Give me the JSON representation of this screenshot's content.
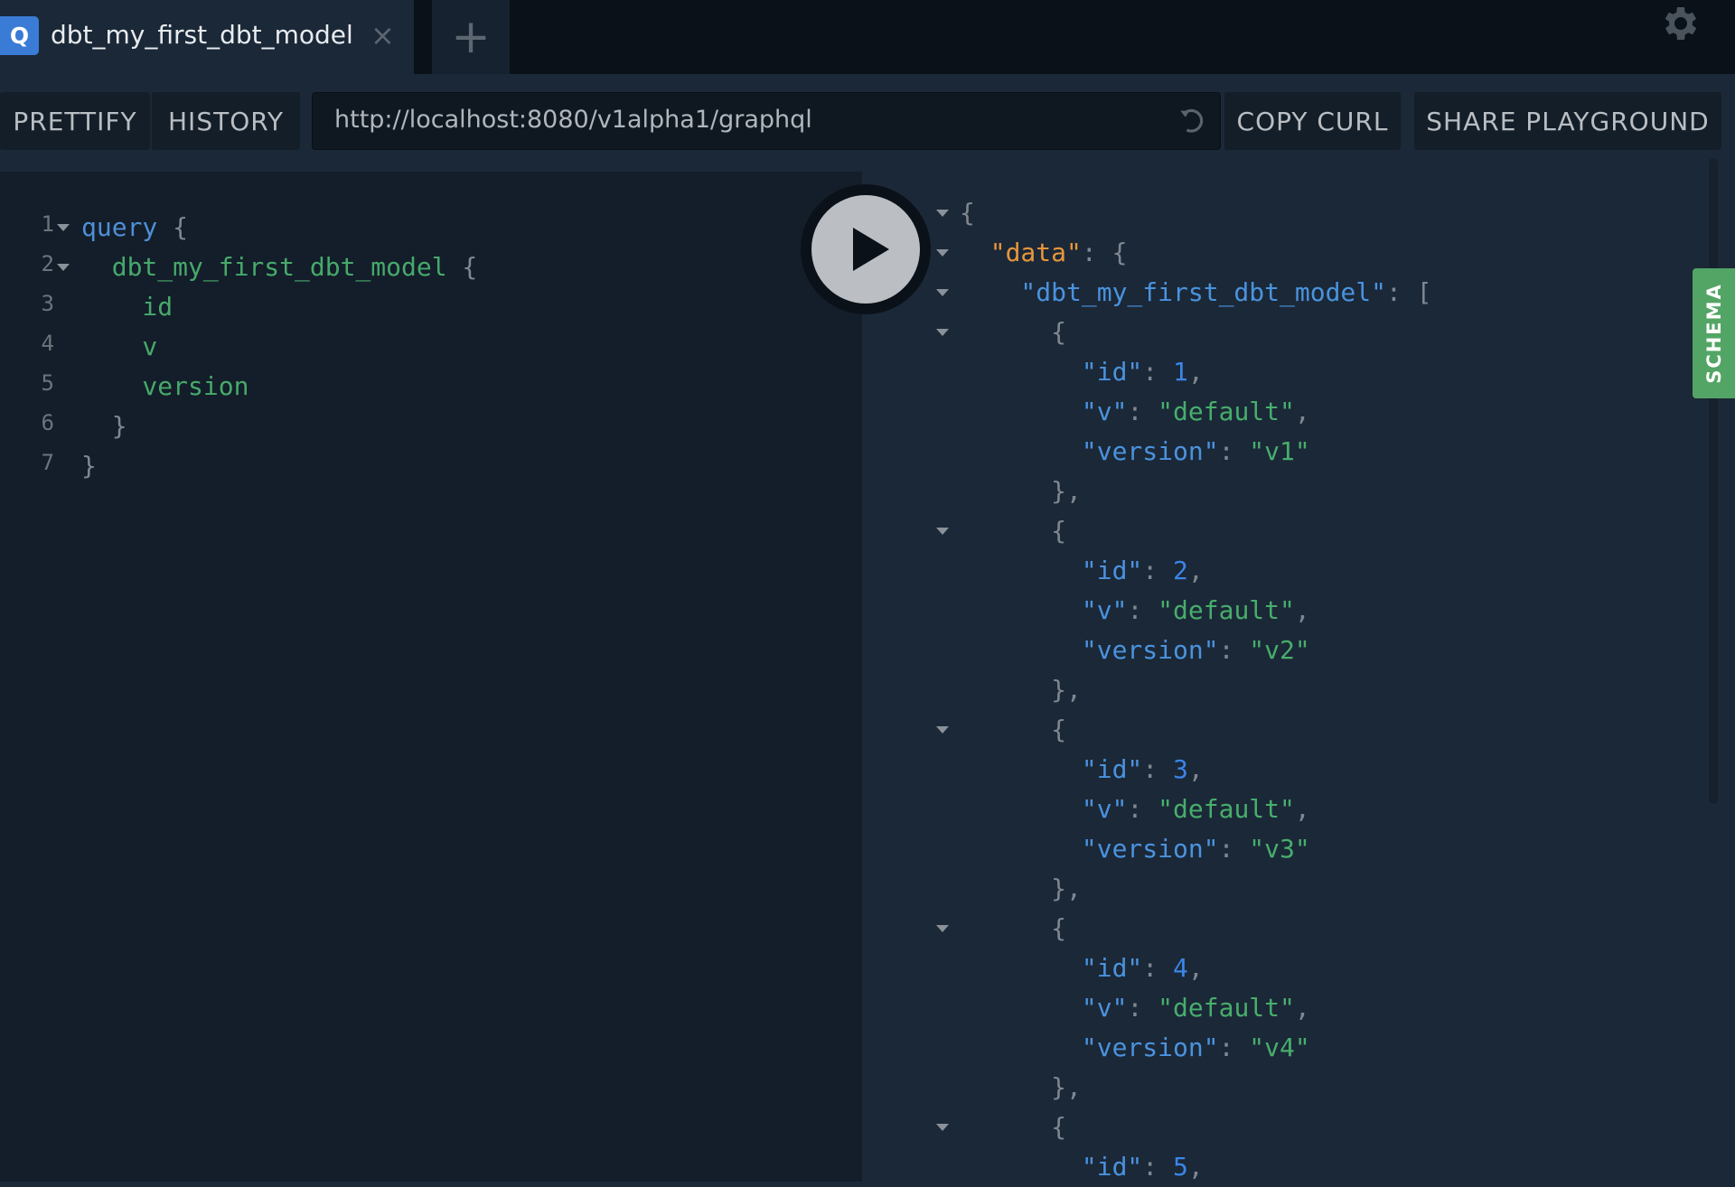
{
  "colors": {
    "accent": "#3a7bd5",
    "schema": "#53a565",
    "keyword": "#4f8fd6",
    "field": "#47a96a",
    "key": "#4a93de",
    "data_key": "#e8963a",
    "number": "#3b85e6",
    "string": "#47ae6b",
    "punct": "#7f8790"
  },
  "tabs": [
    {
      "badge": "Q",
      "title": "dbt_my_first_dbt_model",
      "close_icon": "×"
    }
  ],
  "new_tab_label": "+",
  "toolbar": {
    "prettify": "PRETTIFY",
    "history": "HISTORY",
    "endpoint": "http://localhost:8080/v1alpha1/graphql",
    "copy_curl": "COPY CURL",
    "share": "SHARE PLAYGROUND"
  },
  "schema_tab": "SCHEMA",
  "query_lines": [
    {
      "num": "1",
      "fold": true,
      "tokens": [
        [
          "keyword",
          "query"
        ],
        [
          "punct",
          " {"
        ]
      ]
    },
    {
      "num": "2",
      "fold": true,
      "tokens": [
        [
          "field",
          "  dbt_my_first_dbt_model"
        ],
        [
          "punct",
          " {"
        ]
      ]
    },
    {
      "num": "3",
      "tokens": [
        [
          "field",
          "    id"
        ]
      ]
    },
    {
      "num": "4",
      "tokens": [
        [
          "field",
          "    v"
        ]
      ]
    },
    {
      "num": "5",
      "tokens": [
        [
          "field",
          "    version"
        ]
      ]
    },
    {
      "num": "6",
      "tokens": [
        [
          "punct",
          "  }"
        ]
      ]
    },
    {
      "num": "7",
      "tokens": [
        [
          "punct",
          "}"
        ]
      ]
    }
  ],
  "result_lines": [
    {
      "fold": true,
      "tokens": [
        [
          "punct",
          "{"
        ]
      ]
    },
    {
      "fold": true,
      "tokens": [
        [
          "data_key",
          "  \"data\""
        ],
        [
          "punct",
          ": {"
        ]
      ]
    },
    {
      "fold": true,
      "tokens": [
        [
          "key",
          "    \"dbt_my_first_dbt_model\""
        ],
        [
          "punct",
          ": ["
        ]
      ]
    },
    {
      "fold": true,
      "tokens": [
        [
          "punct",
          "      {"
        ]
      ]
    },
    {
      "tokens": [
        [
          "key",
          "        \"id\""
        ],
        [
          "punct",
          ": "
        ],
        [
          "number",
          "1"
        ],
        [
          "punct",
          ","
        ]
      ]
    },
    {
      "tokens": [
        [
          "key",
          "        \"v\""
        ],
        [
          "punct",
          ": "
        ],
        [
          "string",
          "\"default\""
        ],
        [
          "punct",
          ","
        ]
      ]
    },
    {
      "tokens": [
        [
          "key",
          "        \"version\""
        ],
        [
          "punct",
          ": "
        ],
        [
          "string",
          "\"v1\""
        ]
      ]
    },
    {
      "tokens": [
        [
          "punct",
          "      },"
        ]
      ]
    },
    {
      "fold": true,
      "tokens": [
        [
          "punct",
          "      {"
        ]
      ]
    },
    {
      "tokens": [
        [
          "key",
          "        \"id\""
        ],
        [
          "punct",
          ": "
        ],
        [
          "number",
          "2"
        ],
        [
          "punct",
          ","
        ]
      ]
    },
    {
      "tokens": [
        [
          "key",
          "        \"v\""
        ],
        [
          "punct",
          ": "
        ],
        [
          "string",
          "\"default\""
        ],
        [
          "punct",
          ","
        ]
      ]
    },
    {
      "tokens": [
        [
          "key",
          "        \"version\""
        ],
        [
          "punct",
          ": "
        ],
        [
          "string",
          "\"v2\""
        ]
      ]
    },
    {
      "tokens": [
        [
          "punct",
          "      },"
        ]
      ]
    },
    {
      "fold": true,
      "tokens": [
        [
          "punct",
          "      {"
        ]
      ]
    },
    {
      "tokens": [
        [
          "key",
          "        \"id\""
        ],
        [
          "punct",
          ": "
        ],
        [
          "number",
          "3"
        ],
        [
          "punct",
          ","
        ]
      ]
    },
    {
      "tokens": [
        [
          "key",
          "        \"v\""
        ],
        [
          "punct",
          ": "
        ],
        [
          "string",
          "\"default\""
        ],
        [
          "punct",
          ","
        ]
      ]
    },
    {
      "tokens": [
        [
          "key",
          "        \"version\""
        ],
        [
          "punct",
          ": "
        ],
        [
          "string",
          "\"v3\""
        ]
      ]
    },
    {
      "tokens": [
        [
          "punct",
          "      },"
        ]
      ]
    },
    {
      "fold": true,
      "tokens": [
        [
          "punct",
          "      {"
        ]
      ]
    },
    {
      "tokens": [
        [
          "key",
          "        \"id\""
        ],
        [
          "punct",
          ": "
        ],
        [
          "number",
          "4"
        ],
        [
          "punct",
          ","
        ]
      ]
    },
    {
      "tokens": [
        [
          "key",
          "        \"v\""
        ],
        [
          "punct",
          ": "
        ],
        [
          "string",
          "\"default\""
        ],
        [
          "punct",
          ","
        ]
      ]
    },
    {
      "tokens": [
        [
          "key",
          "        \"version\""
        ],
        [
          "punct",
          ": "
        ],
        [
          "string",
          "\"v4\""
        ]
      ]
    },
    {
      "tokens": [
        [
          "punct",
          "      },"
        ]
      ]
    },
    {
      "fold": true,
      "tokens": [
        [
          "punct",
          "      {"
        ]
      ]
    },
    {
      "tokens": [
        [
          "key",
          "        \"id\""
        ],
        [
          "punct",
          ": "
        ],
        [
          "number",
          "5"
        ],
        [
          "punct",
          ","
        ]
      ]
    }
  ]
}
